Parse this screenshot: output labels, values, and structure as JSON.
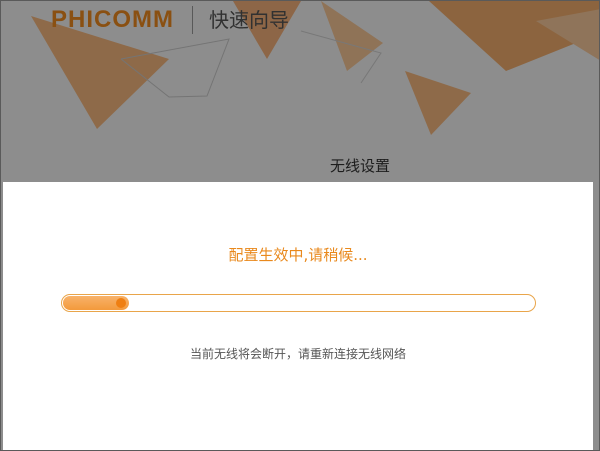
{
  "header": {
    "logo_text": "PHICOMM",
    "app_title": "快速向导"
  },
  "wizard": {
    "step_title": "无线设置"
  },
  "modal": {
    "message": "配置生效中,请稍候...",
    "progress_fraction": 0.08,
    "hint": "当前无线将会断开，请重新连接无线网络"
  },
  "colors": {
    "accent": "#ee8b1f",
    "progress_border": "#e9a54a",
    "progress_fill": "#f39a3b",
    "overlay": "rgba(0,0,0,0.42)"
  }
}
